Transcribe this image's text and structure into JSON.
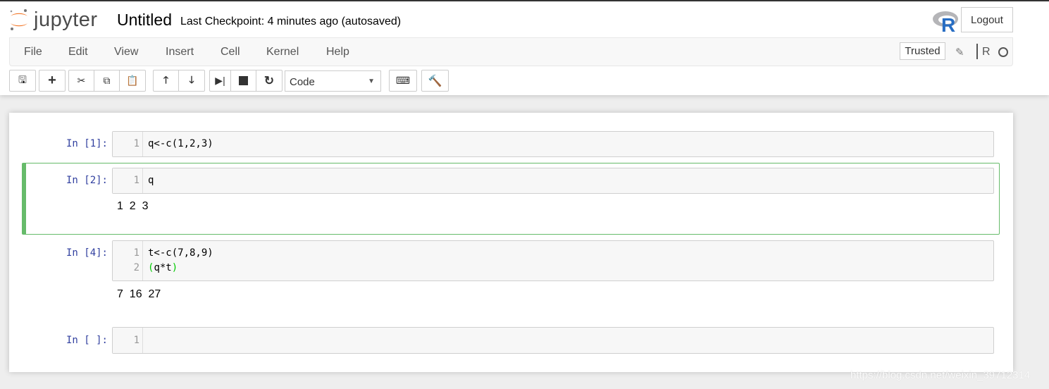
{
  "header": {
    "logo_text": "jupyter",
    "title": "Untitled",
    "checkpoint": "Last Checkpoint: 4 minutes ago (autosaved)",
    "logout": "Logout"
  },
  "menu": {
    "items": [
      "File",
      "Edit",
      "View",
      "Insert",
      "Cell",
      "Kernel",
      "Help"
    ],
    "trusted": "Trusted",
    "kernel_name": "R"
  },
  "toolbar": {
    "cell_type": "Code",
    "icons": [
      "save-icon",
      "plus-icon",
      "cut-icon",
      "copy-icon",
      "paste-icon",
      "arrow-up-icon",
      "arrow-down-icon",
      "run-icon",
      "stop-icon",
      "restart-icon",
      "keyboard-icon",
      "command-palette-icon"
    ]
  },
  "cells": [
    {
      "prompt": "In [1]:",
      "lines": [
        "q<-c(1,2,3)"
      ],
      "line_numbers": [
        "1"
      ],
      "output": ""
    },
    {
      "prompt": "In [2]:",
      "lines": [
        "q"
      ],
      "line_numbers": [
        "1"
      ],
      "output": "1  2  3"
    },
    {
      "prompt": "In [4]:",
      "lines": [
        "t<-c(7,8,9)",
        "(q*t)"
      ],
      "line_numbers": [
        "1",
        "2"
      ],
      "output": "7  16  27"
    },
    {
      "prompt": "In [ ]:",
      "lines": [
        ""
      ],
      "line_numbers": [
        "1"
      ],
      "output": ""
    }
  ],
  "watermark": "https://blog.csdn.net/weixin_39712314",
  "colors": {
    "accent_selected": "#66bb6a",
    "prompt": "#303f9f",
    "logo_orange": "#f37626"
  }
}
